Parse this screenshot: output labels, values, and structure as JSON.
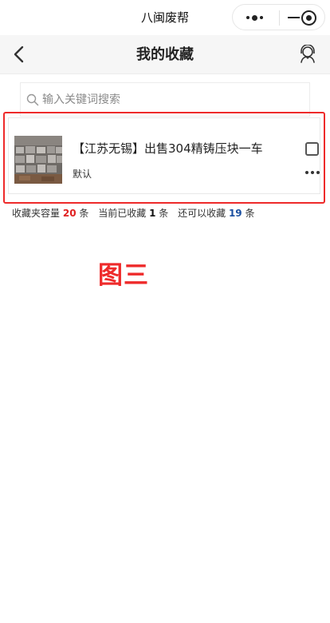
{
  "topbar": {
    "title": "八闽废帮"
  },
  "capsule": {
    "more_icon": "more-dots-icon",
    "minimize_icon": "minus-icon",
    "close_icon": "target-circle-icon"
  },
  "header": {
    "back_icon": "chevron-left-icon",
    "title": "我的收藏",
    "service_icon": "customer-service-icon"
  },
  "search": {
    "placeholder": "输入关键词搜索",
    "value": ""
  },
  "favorites": [
    {
      "title": "【江苏无锡】出售304精铸压块一车",
      "tag": "默认",
      "checked": false
    }
  ],
  "stats": {
    "capacity_label": "收藏夹容量",
    "capacity": "20",
    "unit1": "条",
    "current_label": "当前已收藏",
    "current": "1",
    "unit2": "条",
    "remaining_label": "还可以收藏",
    "remaining": "19",
    "unit3": "条"
  },
  "annotation": "图三",
  "colors": {
    "highlight": "#ee2a2a",
    "capacity": "#e02020",
    "remaining": "#1a4fa0"
  }
}
